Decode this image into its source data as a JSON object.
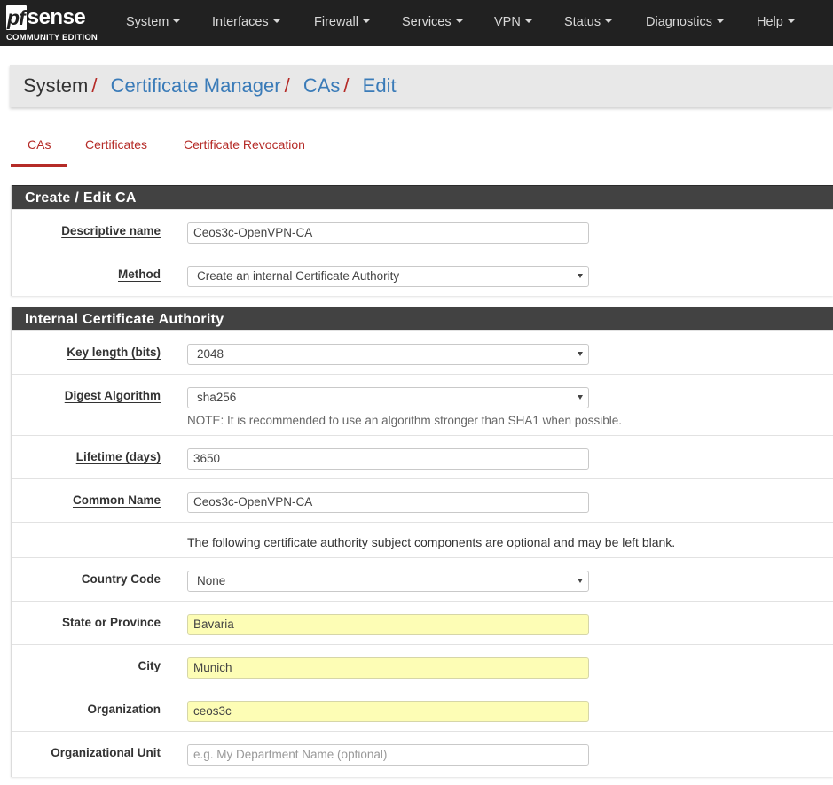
{
  "brand": {
    "logo_pf": "pf",
    "logo_sense": "sense",
    "logo_sub": "COMMUNITY EDITION"
  },
  "nav": {
    "items": [
      {
        "label": "System"
      },
      {
        "label": "Interfaces"
      },
      {
        "label": "Firewall"
      },
      {
        "label": "Services"
      },
      {
        "label": "VPN"
      },
      {
        "label": "Status"
      },
      {
        "label": "Diagnostics"
      },
      {
        "label": "Help"
      }
    ]
  },
  "breadcrumb": {
    "items": [
      "System",
      "Certificate Manager",
      "CAs",
      "Edit"
    ],
    "separator": "/"
  },
  "tabs": [
    {
      "label": "CAs",
      "active": true
    },
    {
      "label": "Certificates",
      "active": false
    },
    {
      "label": "Certificate Revocation",
      "active": false
    }
  ],
  "panel_create": {
    "title": "Create / Edit CA",
    "descriptive_name": {
      "label": "Descriptive name",
      "value": "Ceos3c-OpenVPN-CA"
    },
    "method": {
      "label": "Method",
      "value": "Create an internal Certificate Authority"
    }
  },
  "panel_internal": {
    "title": "Internal Certificate Authority",
    "key_length": {
      "label": "Key length (bits)",
      "value": "2048"
    },
    "digest": {
      "label": "Digest Algorithm",
      "value": "sha256",
      "note": "NOTE: It is recommended to use an algorithm stronger than SHA1 when possible."
    },
    "lifetime": {
      "label": "Lifetime (days)",
      "value": "3650"
    },
    "common_name": {
      "label": "Common Name",
      "value": "Ceos3c-OpenVPN-CA"
    },
    "optional_note": "The following certificate authority subject components are optional and may be left blank.",
    "country": {
      "label": "Country Code",
      "value": "None"
    },
    "state": {
      "label": "State or Province",
      "value": "Bavaria"
    },
    "city": {
      "label": "City",
      "value": "Munich"
    },
    "organization": {
      "label": "Organization",
      "value": "ceos3c"
    },
    "org_unit": {
      "label": "Organizational Unit",
      "placeholder": "e.g. My Department Name (optional)"
    }
  },
  "colors": {
    "navbar_bg": "#212121",
    "link": "#3a7bb8",
    "accent_red": "#b52b27",
    "panel_heading": "#424242",
    "autofill_yellow": "#fdfdb5"
  }
}
